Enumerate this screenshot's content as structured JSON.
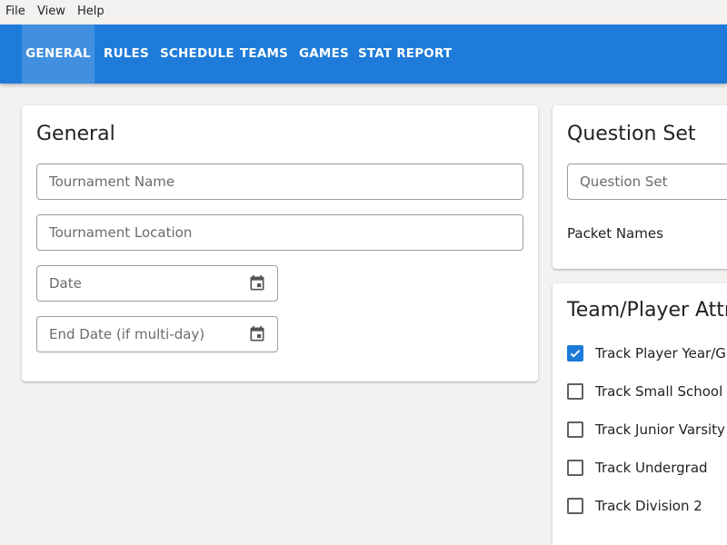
{
  "menubar": {
    "items": [
      "File",
      "View",
      "Help"
    ]
  },
  "tabs": [
    {
      "label": "GENERAL",
      "active": true
    },
    {
      "label": "RULES"
    },
    {
      "label": "SCHEDULE"
    },
    {
      "label": "TEAMS"
    },
    {
      "label": "GAMES"
    },
    {
      "label": "STAT REPORT"
    }
  ],
  "colors": {
    "accent": "#1e7bd9",
    "active_tab": "#4190e0",
    "background": "#f3f2f1"
  },
  "general": {
    "title": "General",
    "tournament_name": {
      "placeholder": "Tournament Name",
      "value": ""
    },
    "tournament_location": {
      "placeholder": "Tournament Location",
      "value": ""
    },
    "date": {
      "placeholder": "Date",
      "value": "",
      "icon": "calendar-icon"
    },
    "end_date": {
      "placeholder": "End Date (if multi-day)",
      "value": "",
      "icon": "calendar-icon"
    }
  },
  "question_set": {
    "title": "Question Set",
    "question_set_field": {
      "placeholder": "Question Set",
      "value": ""
    },
    "packet_names_label": "Packet Names"
  },
  "team_player": {
    "title": "Team/Player Attr",
    "options": [
      {
        "label": "Track Player Year/Gr",
        "checked": true
      },
      {
        "label": "Track Small School",
        "checked": false
      },
      {
        "label": "Track Junior Varsity",
        "checked": false
      },
      {
        "label": "Track Undergrad",
        "checked": false
      },
      {
        "label": "Track Division 2",
        "checked": false
      }
    ]
  }
}
